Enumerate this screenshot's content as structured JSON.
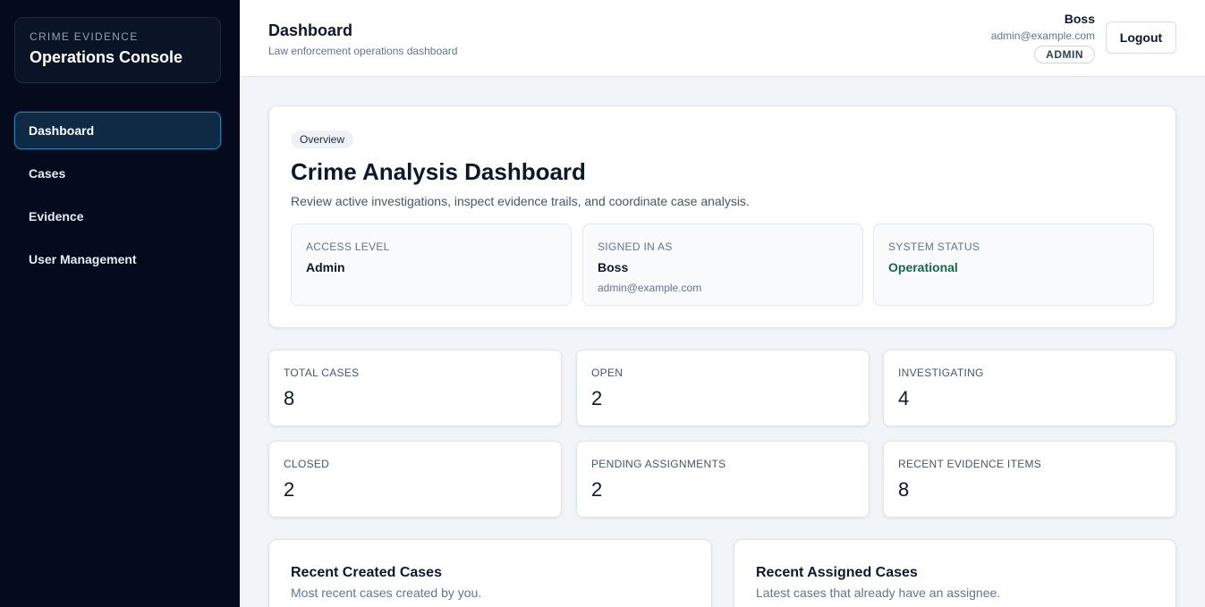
{
  "brand": {
    "kicker": "CRIME EVIDENCE",
    "title": "Operations Console"
  },
  "nav": [
    {
      "label": "Dashboard",
      "active": true
    },
    {
      "label": "Cases"
    },
    {
      "label": "Evidence"
    },
    {
      "label": "User Management"
    }
  ],
  "header": {
    "title": "Dashboard",
    "subtitle": "Law enforcement operations dashboard",
    "user_name": "Boss",
    "user_email": "admin@example.com",
    "role": "ADMIN",
    "logout_label": "Logout"
  },
  "overview": {
    "pill": "Overview",
    "title": "Crime Analysis Dashboard",
    "description": "Review active investigations, inspect evidence trails, and coordinate case analysis.",
    "cards": [
      {
        "label": "ACCESS LEVEL",
        "value": "Admin"
      },
      {
        "label": "SIGNED IN AS",
        "value": "Boss",
        "sub": "admin@example.com"
      },
      {
        "label": "SYSTEM STATUS",
        "value": "Operational"
      }
    ]
  },
  "stats": [
    {
      "label": "TOTAL CASES",
      "value": "8"
    },
    {
      "label": "OPEN",
      "value": "2"
    },
    {
      "label": "INVESTIGATING",
      "value": "4"
    },
    {
      "label": "CLOSED",
      "value": "2"
    },
    {
      "label": "PENDING ASSIGNMENTS",
      "value": "2"
    },
    {
      "label": "RECENT EVIDENCE ITEMS",
      "value": "8"
    }
  ],
  "panels": {
    "created": {
      "title": "Recent Created Cases",
      "subtitle": "Most recent cases created by you."
    },
    "assigned": {
      "title": "Recent Assigned Cases",
      "subtitle": "Latest cases that already have an assignee."
    }
  },
  "colors": {
    "sidebar": "#050b1c",
    "accent": "#2a7bb0",
    "status_ok": "#116b4a"
  }
}
